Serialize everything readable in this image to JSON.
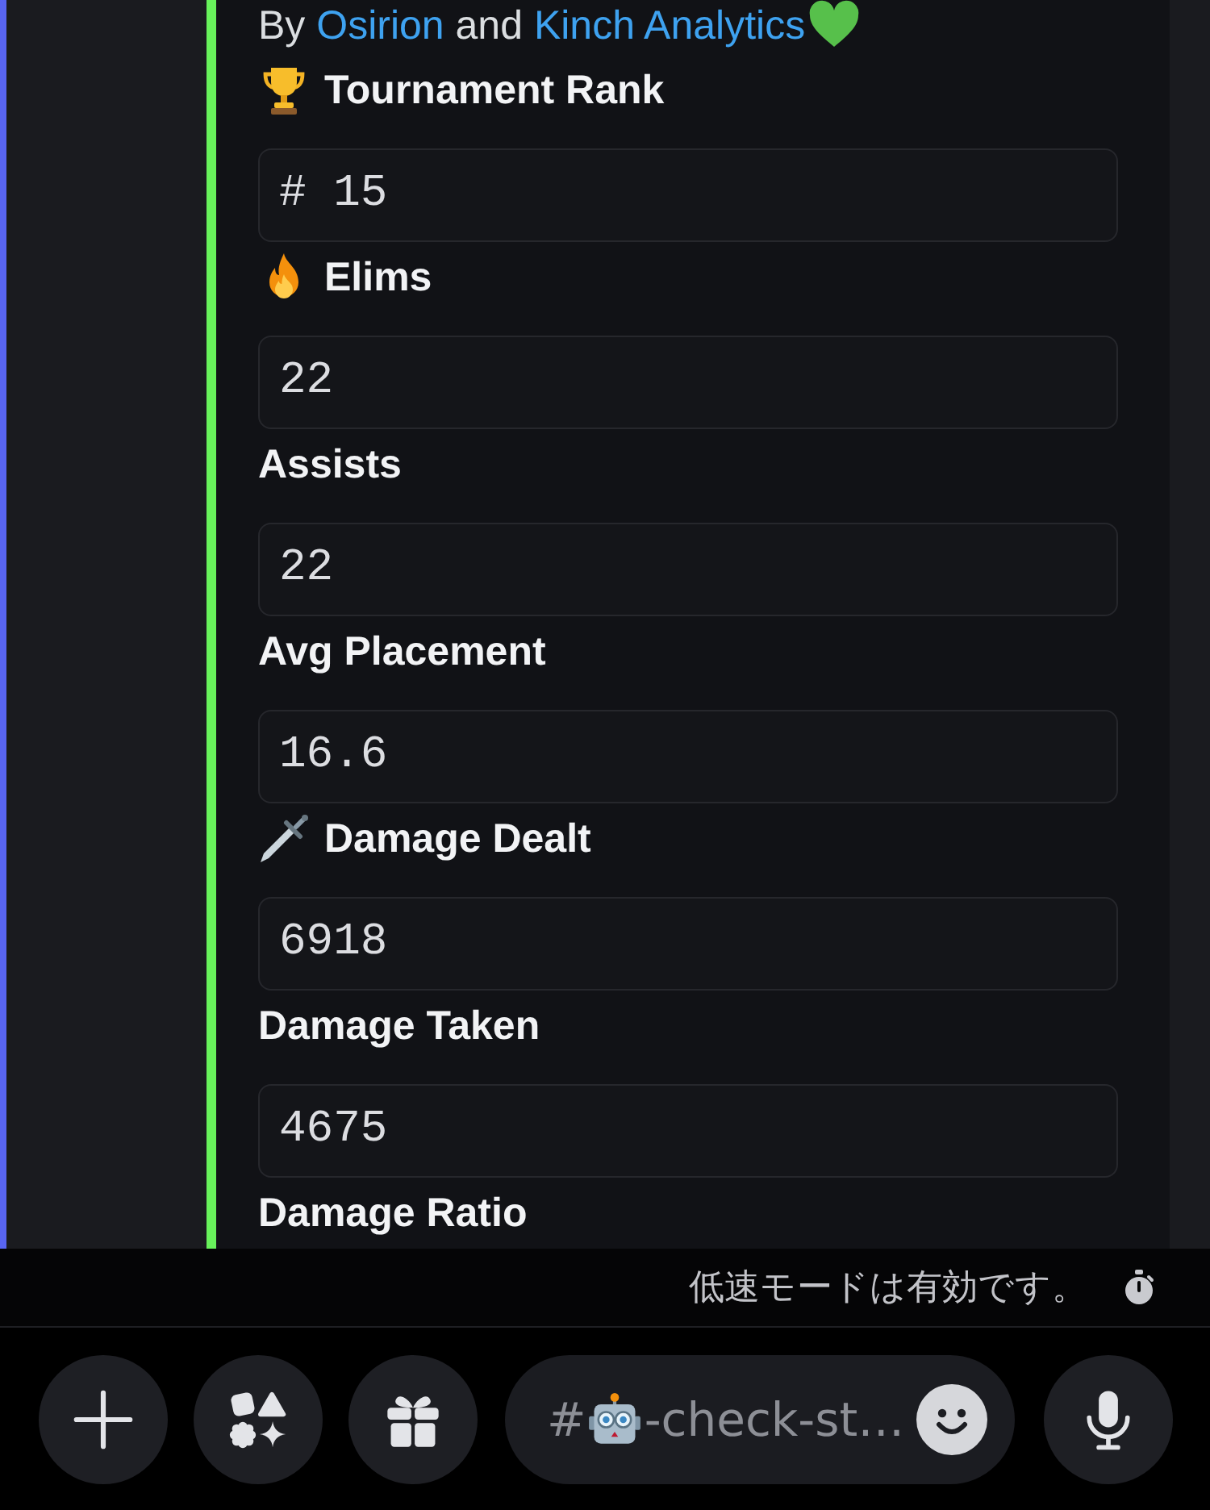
{
  "byline": {
    "parts": [
      {
        "kind": "text",
        "text": "By"
      },
      {
        "kind": "link",
        "text": "Osirion"
      },
      {
        "kind": "text",
        "text": "and"
      },
      {
        "kind": "link",
        "text": "Kinch Analytics"
      }
    ]
  },
  "stats": [
    {
      "kind": "trophy",
      "label": "Tournament Rank",
      "value": "# 15"
    },
    {
      "kind": "fire",
      "label": "Elims",
      "value": "22"
    },
    {
      "kind": "plain",
      "label": "Assists",
      "value": "22"
    },
    {
      "kind": "plain",
      "label": "Avg Placement",
      "value": "16.6"
    },
    {
      "kind": "sword",
      "label": "Damage Dealt",
      "value": "6918"
    },
    {
      "kind": "plain",
      "label": "Damage Taken",
      "value": "4675"
    },
    {
      "kind": "plain",
      "label": "Damage Ratio"
    }
  ],
  "slow_mode": {
    "text": "低速モードは有効です。"
  },
  "composer": {
    "channel_prefix": "#",
    "channel_name": "-check-st…"
  }
}
